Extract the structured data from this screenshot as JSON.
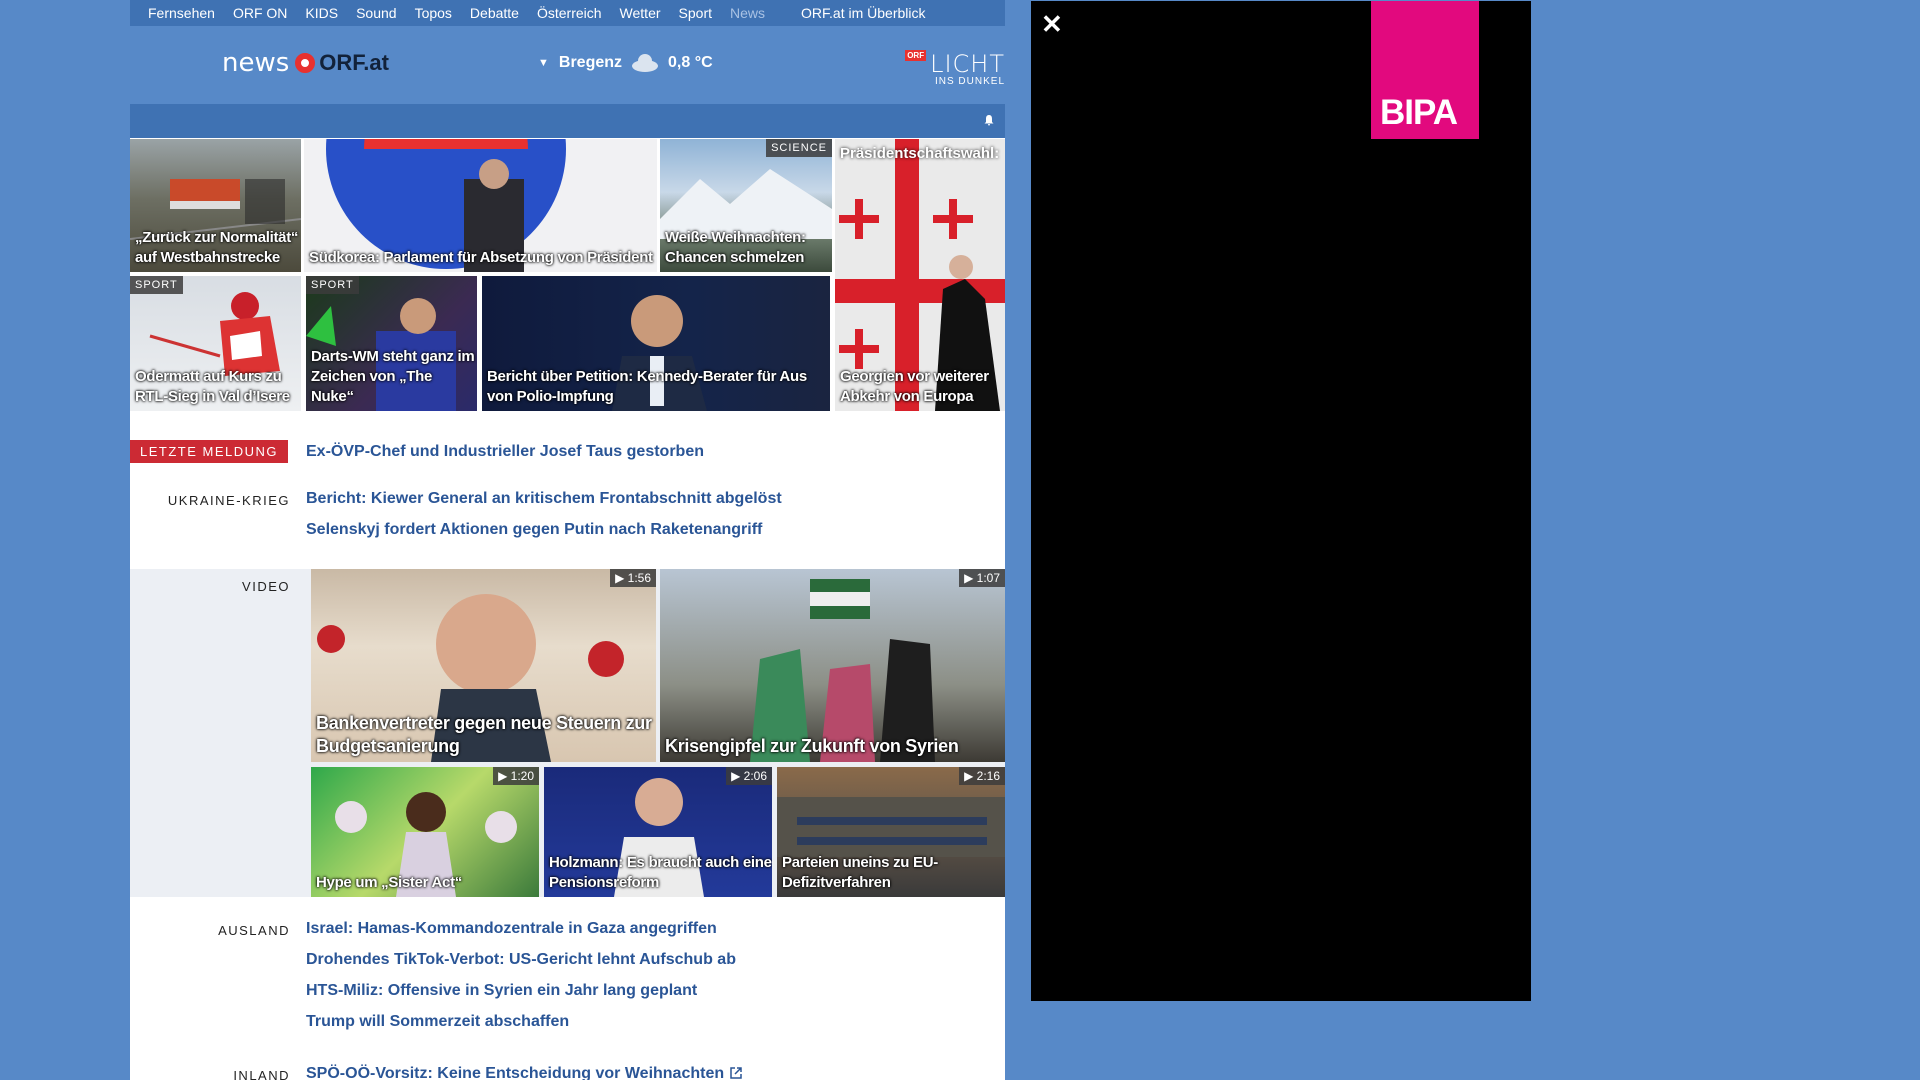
{
  "nav": {
    "items": [
      "Fernsehen",
      "ORF ON",
      "KIDS",
      "Sound",
      "Topos",
      "Debatte",
      "Österreich",
      "Wetter",
      "Sport",
      "News"
    ],
    "overview": "ORF.at im Überblick"
  },
  "header": {
    "logo_news": "news",
    "logo_orf": "ORF.at",
    "weather_city": "Bregenz",
    "weather_temp": "0,8 °C",
    "licht_orf": "ORF",
    "licht_big": "LICHT",
    "licht_small": "INS DUNKEL"
  },
  "tiles": [
    {
      "caption": "„Zurück zur Normalität“ auf Westbahnstrecke"
    },
    {
      "caption": "Südkorea: Parlament für Absetzung von Präsident"
    },
    {
      "caption": "Weiße Weihnachten: Chancen schmelzen",
      "tag": "SCIENCE"
    },
    {
      "caption": "Georgien vor weiterer Abkehr von Europa",
      "top": "Präsidentschaftswahl:"
    },
    {
      "caption": "Odermatt auf Kurs zu RTL-Sieg in Val d’Isere",
      "tag": "SPORT"
    },
    {
      "caption": "Darts-WM steht ganz im Zeichen von „The Nuke“",
      "tag": "SPORT"
    },
    {
      "caption": "Bericht über Petition: Kennedy-Berater für Aus von Polio-Impfung"
    }
  ],
  "latest": {
    "label": "LETZTE MELDUNG",
    "link": "Ex-ÖVP-Chef und Industrieller Josef Taus gestorben"
  },
  "ukraine": {
    "label": "UKRAINE-KRIEG",
    "links": [
      "Bericht: Kiewer General an kritischem Frontabschnitt abgelöst",
      "Selenskyj fordert Aktionen gegen Putin nach Raketenangriff"
    ]
  },
  "video": {
    "label": "VIDEO",
    "items": [
      {
        "caption": "Bankenvertreter gegen neue Steuern zur Budgetsanierung",
        "duration": "1:56"
      },
      {
        "caption": "Krisengipfel zur Zukunft von Syrien",
        "duration": "1:07"
      },
      {
        "caption": "Hype um „Sister Act“",
        "duration": "1:20"
      },
      {
        "caption": "Holzmann: Es braucht auch eine Pensionsreform",
        "duration": "2:06"
      },
      {
        "caption": "Parteien uneins zu EU-Defizitverfahren",
        "duration": "2:16"
      }
    ]
  },
  "ausland": {
    "label": "AUSLAND",
    "links": [
      "Israel: Hamas-Kommandozentrale in Gaza angegriffen",
      "Drohendes TikTok-Verbot: US-Gericht lehnt Aufschub ab",
      "HTS-Miliz: Offensive in Syrien ein Jahr lang geplant",
      "Trump will Sommerzeit abschaffen"
    ]
  },
  "inland": {
    "label": "INLAND",
    "links": [
      "SPÖ-OÖ-Vorsitz: Keine Entscheidung vor Weihnachten"
    ]
  },
  "ad": {
    "brand": "BIPA",
    "close": "✕"
  }
}
